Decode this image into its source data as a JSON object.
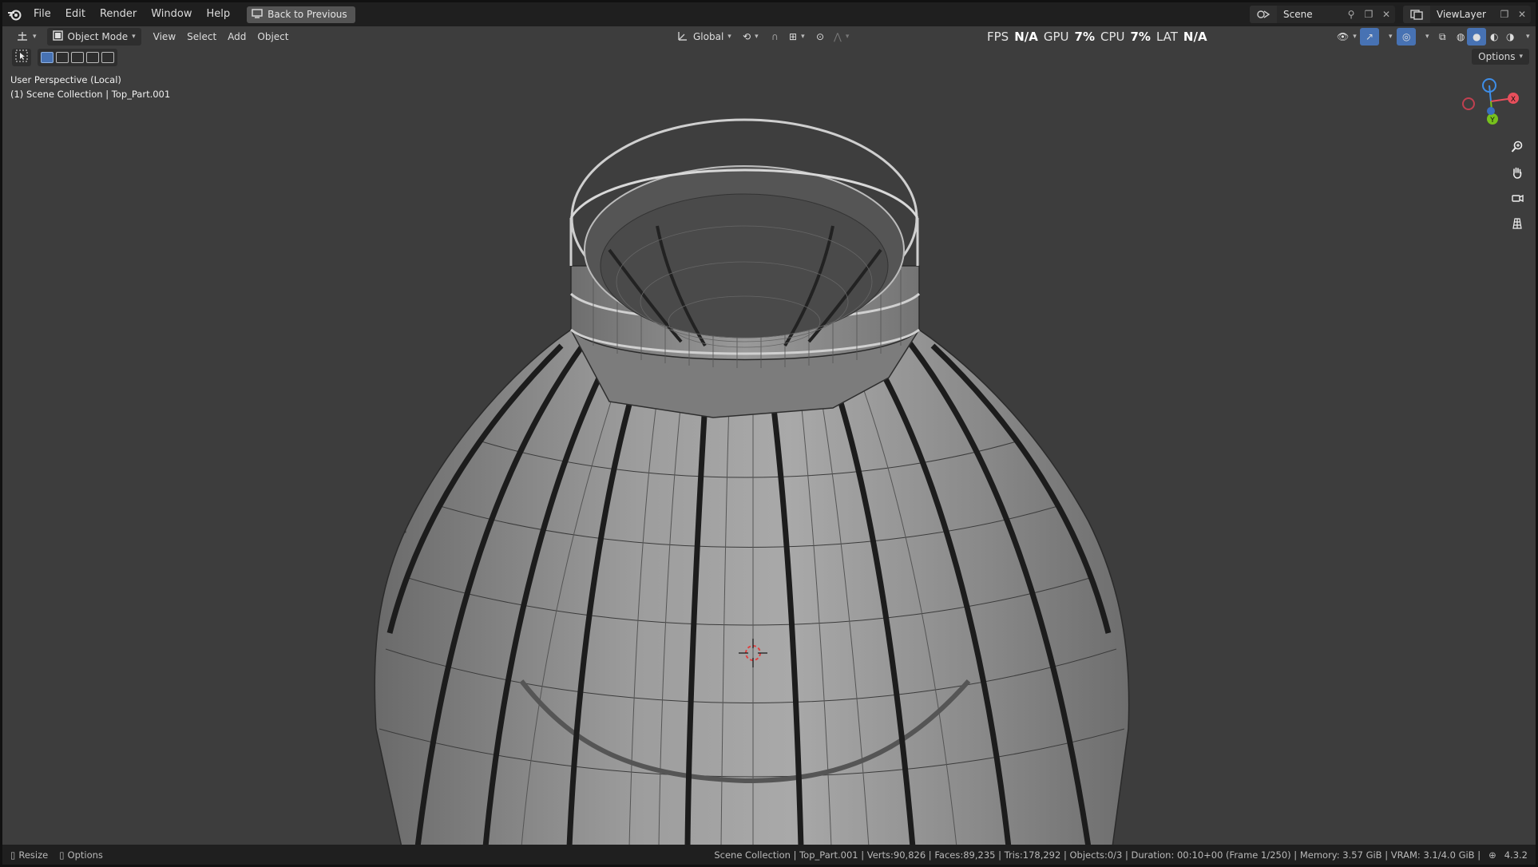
{
  "menubar": {
    "items": [
      "File",
      "Edit",
      "Render",
      "Window",
      "Help"
    ],
    "back_button": "Back to Previous",
    "scene": "Scene",
    "view_layer": "ViewLayer"
  },
  "viewport_header": {
    "mode": "Object Mode",
    "menus": [
      "View",
      "Select",
      "Add",
      "Object"
    ],
    "orientation": "Global",
    "stats": {
      "fps_label": "FPS",
      "fps_value": "N/A",
      "gpu_label": "GPU",
      "gpu_value": "7%",
      "cpu_label": "CPU",
      "cpu_value": "7%",
      "lat_label": "LAT",
      "lat_value": "N/A"
    },
    "options": "Options"
  },
  "viewport_info": {
    "perspective": "User Perspective (Local)",
    "collection": "(1) Scene Collection | Top_Part.001"
  },
  "gizmo": {
    "x": "X",
    "y": "Y",
    "z": "Z"
  },
  "statusbar": {
    "left": [
      "Resize",
      "Options"
    ],
    "info": "Scene Collection | Top_Part.001 | Verts:90,826 | Faces:89,235 | Tris:178,292 | Objects:0/3 | Duration: 00:10+00 (Frame 1/250) | Memory: 3.57 GiB | VRAM: 3.1/4.0 GiB |",
    "version": "4.3.2"
  },
  "colors": {
    "viewport_bg": "#3d3d3d",
    "accent": "#4772b3",
    "axis_x": "#e84f5c",
    "axis_y": "#77c11d",
    "axis_z": "#3e8ee8"
  }
}
